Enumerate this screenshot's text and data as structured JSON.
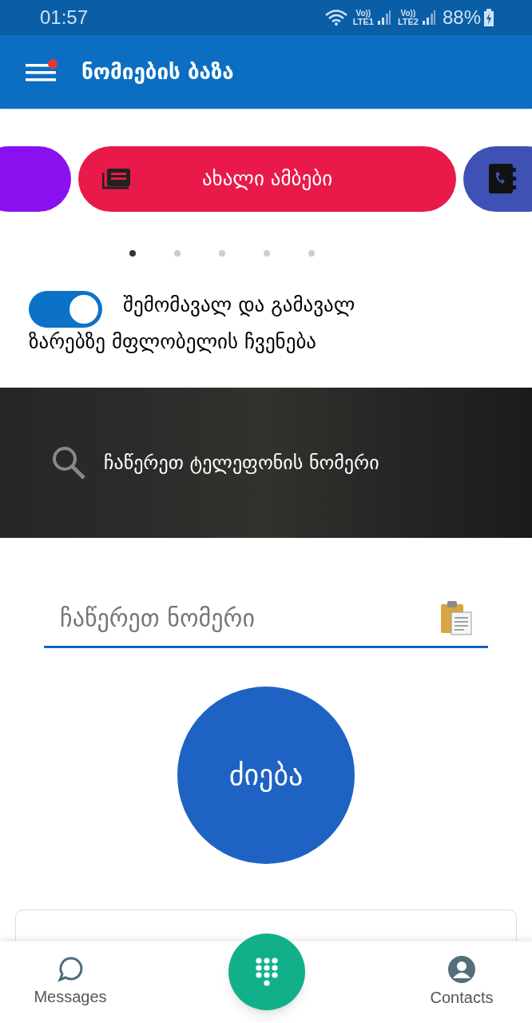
{
  "status_bar": {
    "time": "01:57",
    "sims": [
      {
        "volte": "Vo))",
        "label": "LTE1"
      },
      {
        "volte": "Vo))",
        "label": "LTE2"
      }
    ],
    "battery": "88%"
  },
  "app_bar": {
    "title": "ნომიების ბაზა",
    "menu_badge": true
  },
  "carousel": [
    {
      "kind": "blank",
      "color": "#8b10f0"
    },
    {
      "kind": "news",
      "color": "#e91a4a",
      "label": "ახალი ამბები"
    },
    {
      "kind": "contacts",
      "color": "#3f51b5"
    }
  ],
  "dots": [
    {
      "selected": true
    },
    {
      "selected": false
    },
    {
      "selected": false
    },
    {
      "selected": false
    },
    {
      "selected": false
    }
  ],
  "toggle": {
    "on": true,
    "label_lines": [
      "შემომავალ და გამავალ",
      "ზარებზე მფლობელის ჩვენება"
    ]
  },
  "banner": {
    "text": "ჩაწერეთ ტელეფონის ნომერი"
  },
  "search_field": {
    "placeholder": "ჩაწერეთ ნომერი"
  },
  "search_button": {
    "label": "ძიება"
  },
  "bottom_nav": [
    {
      "kind": "messages",
      "label": "Messages"
    },
    {
      "kind": "contacts",
      "label": "Contacts"
    }
  ]
}
